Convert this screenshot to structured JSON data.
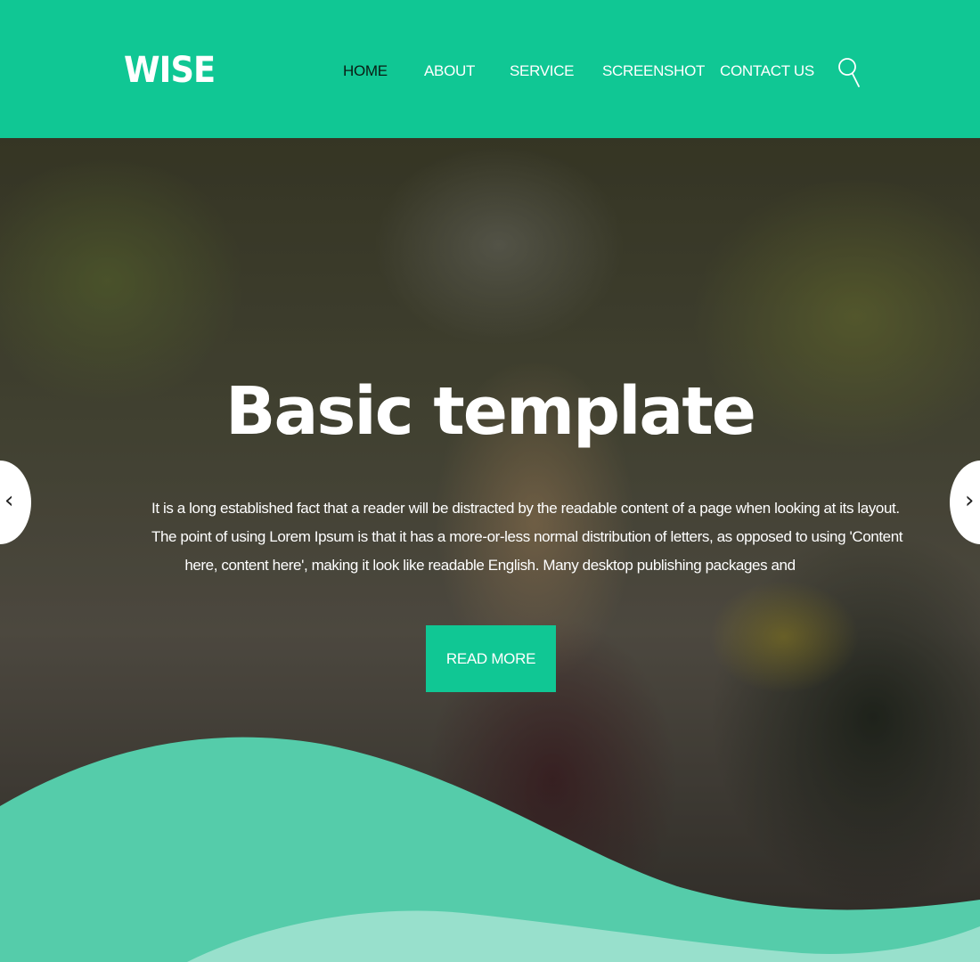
{
  "header": {
    "logo": "WISE",
    "nav": [
      {
        "label": "HOME",
        "active": true
      },
      {
        "label": "ABOUT",
        "active": false
      },
      {
        "label": "SERVICE",
        "active": false
      },
      {
        "label": "SCREENSHOT",
        "active": false
      },
      {
        "label": "CONTACT US",
        "active": false
      }
    ],
    "search_icon": "search-icon"
  },
  "hero": {
    "title": "Basic template",
    "text_lines": [
      "It is a long established fact that a reader will be distracted by the readable content of a page when looking at its layout.",
      "The point of using Lorem Ipsum is that it has a more-or-less normal distribution of letters, as opposed to using 'Content",
      "here, content here', making it look like readable English. Many desktop publishing packages and"
    ],
    "button_label": "READ MORE",
    "prev_arrow": "‹",
    "next_arrow": "›"
  },
  "colors": {
    "accent": "#10c794",
    "wave_front": "#55ccaa",
    "wave_back": "#98e0cc",
    "active_nav": "#0a1d14"
  }
}
